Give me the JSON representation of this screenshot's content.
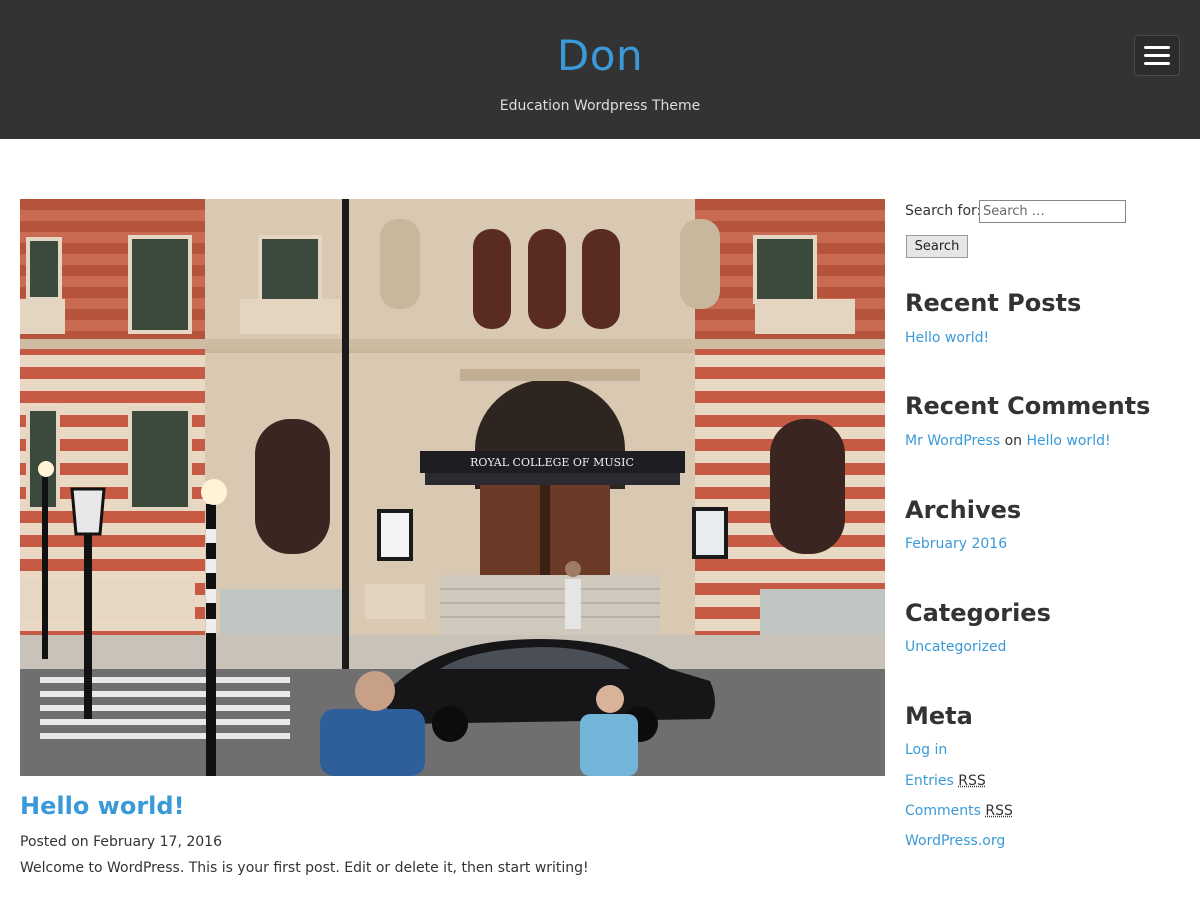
{
  "header": {
    "site_title": "Don",
    "tagline": "Education Wordpress Theme",
    "menu_icon": "hamburger-icon"
  },
  "post": {
    "featured_image_caption_sign": "ROYAL COLLEGE OF MUSIC",
    "title": "Hello world!",
    "meta_prefix": "Posted on",
    "date": "February 17, 2016",
    "excerpt": "Welcome to WordPress. This is your first post. Edit or delete it, then start writing!"
  },
  "sidebar": {
    "search": {
      "label": "Search for:",
      "placeholder": "Search …",
      "button_label": "Search"
    },
    "recent_posts": {
      "title": "Recent Posts",
      "items": [
        "Hello world!"
      ]
    },
    "recent_comments": {
      "title": "Recent Comments",
      "author": "Mr WordPress",
      "connector": "on",
      "post": "Hello world!"
    },
    "archives": {
      "title": "Archives",
      "items": [
        "February 2016"
      ]
    },
    "categories": {
      "title": "Categories",
      "items": [
        "Uncategorized"
      ]
    },
    "meta": {
      "title": "Meta",
      "login": "Log in",
      "entries": "Entries",
      "comments": "Comments",
      "rss": "RSS",
      "wordpress_org": "WordPress.org"
    }
  },
  "colors": {
    "header_bg": "#333333",
    "accent": "#3a9ad9",
    "text": "#333333"
  }
}
